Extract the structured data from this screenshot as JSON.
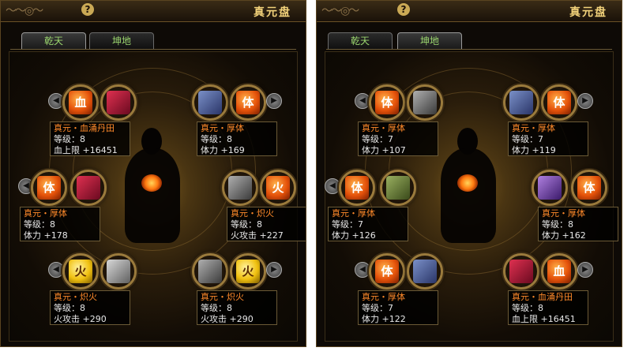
{
  "help_label": "?",
  "panels": [
    {
      "title": "真元盘",
      "tabs": [
        {
          "label": "乾天",
          "active": true
        },
        {
          "label": "坤地",
          "active": false
        }
      ],
      "slots": [
        {
          "gem": "血",
          "gem_color": "orange",
          "equip_color": "red",
          "name": "真元・血涌丹田",
          "level": "等级：8",
          "stat": "血上限 +16451"
        },
        {
          "gem": "体",
          "gem_color": "orange",
          "equip_color": "blue",
          "name": "真元・厚体",
          "level": "等级：8",
          "stat": "体力 +169"
        },
        {
          "gem": "体",
          "gem_color": "orange",
          "equip_color": "red",
          "name": "真元・厚体",
          "level": "等级：8",
          "stat": "体力 +178"
        },
        {
          "gem": "火",
          "gem_color": "orange",
          "equip_color": "gray",
          "name": "真元・炽火",
          "level": "等级：8",
          "stat": "火攻击 +227"
        },
        {
          "gem": "火",
          "gem_color": "yellow",
          "equip_color": "silver",
          "name": "真元・炽火",
          "level": "等级：8",
          "stat": "火攻击 +290"
        },
        {
          "gem": "火",
          "gem_color": "yellow",
          "equip_color": "gray",
          "name": "真元・炽火",
          "level": "等级：8",
          "stat": "火攻击 +290"
        }
      ]
    },
    {
      "title": "真元盘",
      "tabs": [
        {
          "label": "乾天",
          "active": false
        },
        {
          "label": "坤地",
          "active": true
        }
      ],
      "slots": [
        {
          "gem": "体",
          "gem_color": "orange",
          "equip_color": "gray",
          "name": "真元・厚体",
          "level": "等级：7",
          "stat": "体力 +107"
        },
        {
          "gem": "体",
          "gem_color": "orange",
          "equip_color": "blue",
          "name": "真元・厚体",
          "level": "等级：7",
          "stat": "体力 +119"
        },
        {
          "gem": "体",
          "gem_color": "orange",
          "equip_color": "green",
          "name": "真元・厚体",
          "level": "等级：7",
          "stat": "体力 +126"
        },
        {
          "gem": "体",
          "gem_color": "orange",
          "equip_color": "purple",
          "name": "真元・厚体",
          "level": "等级：8",
          "stat": "体力 +162"
        },
        {
          "gem": "体",
          "gem_color": "orange",
          "equip_color": "blue",
          "name": "真元・厚体",
          "level": "等级：7",
          "stat": "体力 +122"
        },
        {
          "gem": "血",
          "gem_color": "orange",
          "equip_color": "red",
          "name": "真元・血涌丹田",
          "level": "等级：8",
          "stat": "血上限 +16451"
        }
      ]
    }
  ]
}
